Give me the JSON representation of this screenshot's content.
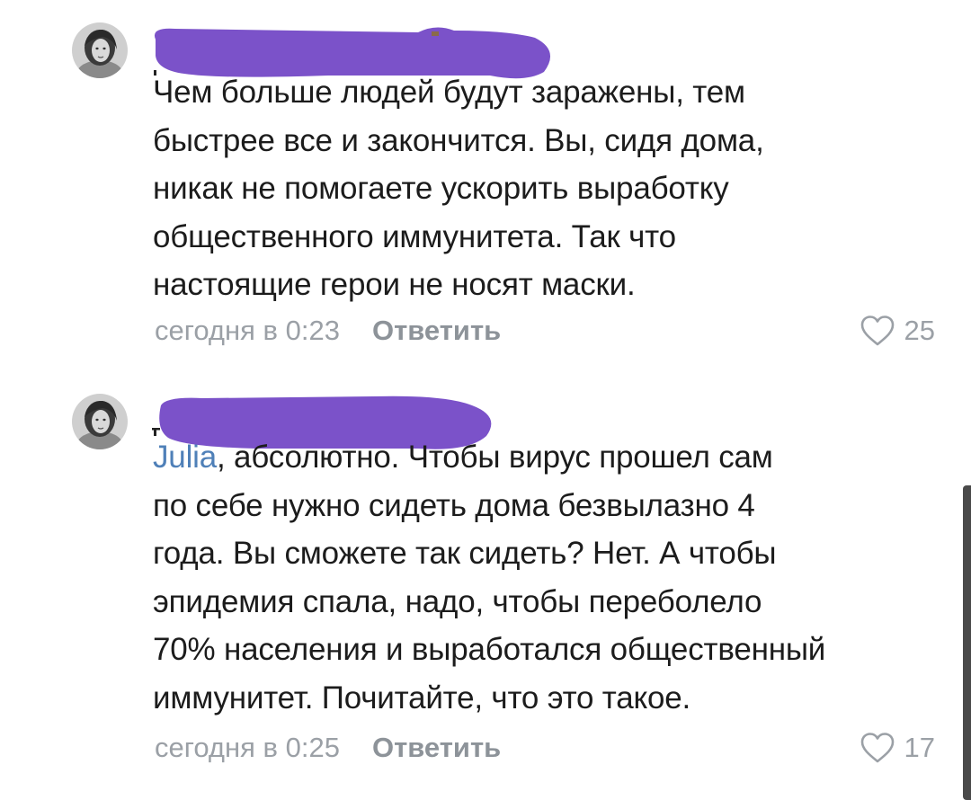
{
  "comments": [
    {
      "author_redacted": true,
      "text": "Чем больше людей будут заражены, тем\nбыстрее все и закончится. Вы, сидя дома,\nникак не помогаете ускорить выработку\nобщественного иммунитета. Так что\nнастоящие герои не носят маски.",
      "timestamp": "сегодня в 0:23",
      "reply_label": "Ответить",
      "likes": "25",
      "like_icon": "heart-outline-icon"
    },
    {
      "author_redacted": true,
      "mention": "Julia",
      "text": ", абсолютно. Чтобы вирус прошел сам\nпо себе нужно сидеть дома безвылазно 4\nгода. Вы сможете так сидеть? Нет. А чтобы\nэпидемия спала, надо, чтобы переболело\n70% населения и выработался общественный\nиммунитет. Почитайте, что это такое.",
      "timestamp": "сегодня в 0:25",
      "reply_label": "Ответить",
      "likes": "17",
      "like_icon": "heart-outline-icon"
    }
  ],
  "colors": {
    "redaction": "#7b52c9",
    "mention": "#4f80b8",
    "meta": "#9ba0a6",
    "text": "#1c1c1c"
  }
}
